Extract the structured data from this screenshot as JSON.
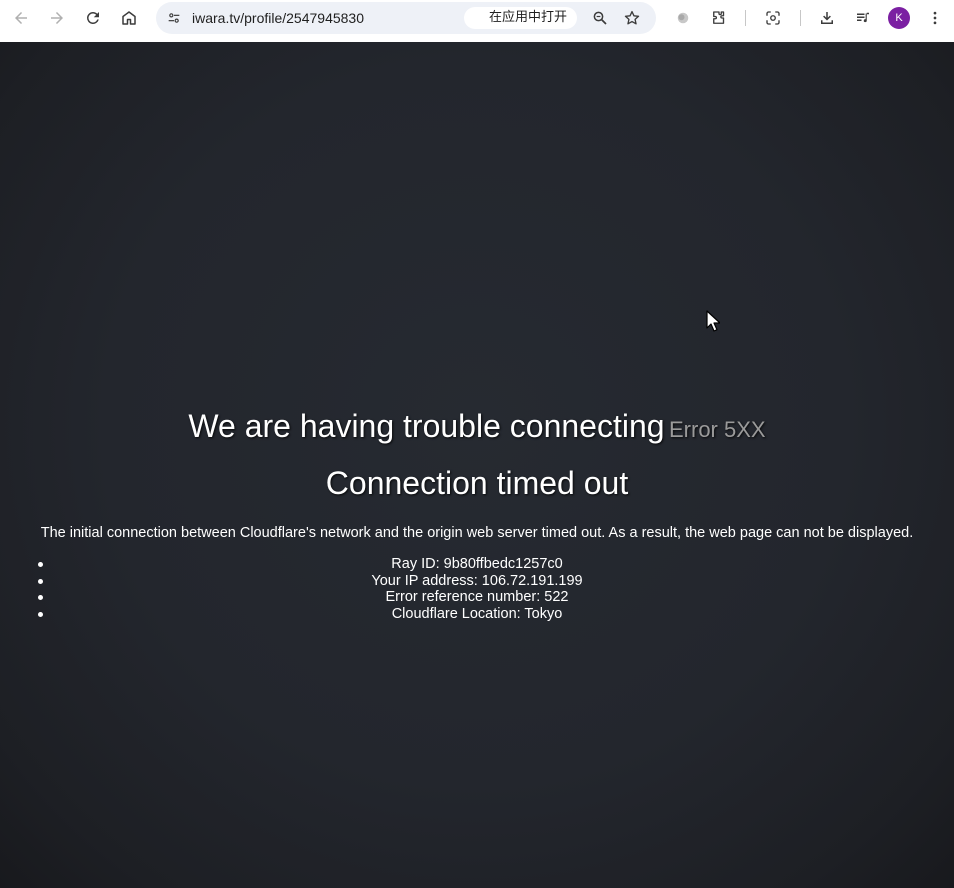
{
  "browser": {
    "url": "iwara.tv/profile/2547945830",
    "open_in_app_label": "在应用中打开",
    "profile_initial": "K",
    "avatar_color": "#7b1fa2"
  },
  "error_page": {
    "heading": "We are having trouble connecting",
    "error_code": "Error 5XX",
    "subheading": "Connection timed out",
    "description": "The initial connection between Cloudflare's network and the origin web server timed out. As a result, the web page can not be displayed.",
    "details": [
      "Ray ID: 9b80ffbedc1257c0",
      "Your IP address: 106.72.191.199",
      "Error reference number: 522",
      "Cloudflare Location: Tokyo"
    ]
  }
}
